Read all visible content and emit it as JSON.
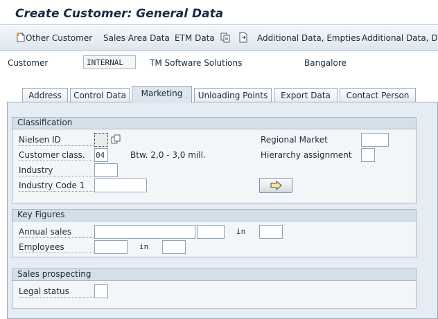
{
  "title": "Create Customer: General Data",
  "toolbar": {
    "other_customer": "Other Customer",
    "sales_area_data": "Sales Area Data",
    "etm_data": "ETM Data",
    "additional_data_empties": "Additional Data, Empties",
    "additional_data_dsd": "Additional Data, DSD",
    "icons": [
      "new-document-icon",
      "copy-icon",
      "export-icon"
    ]
  },
  "customer": {
    "label": "Customer",
    "value": "INTERNAL",
    "name": "TM Software Solutions",
    "city": "Bangalore"
  },
  "tabs": [
    "Address",
    "Control Data",
    "Marketing",
    "Unloading Points",
    "Export Data",
    "Contact Person"
  ],
  "active_tab": "Marketing",
  "classification": {
    "title": "Classification",
    "nielsen_id_label": "Nielsen ID",
    "nielsen_id_value": "",
    "customer_class_label": "Customer class.",
    "customer_class_value": "04",
    "customer_class_desc": "Btw. 2,0 - 3,0 mill.",
    "industry_label": "Industry",
    "industry_value": "",
    "industry_code_label": "Industry Code 1",
    "industry_code_value": "",
    "regional_market_label": "Regional Market",
    "regional_market_value": "",
    "hierarchy_label": "Hierarchy assignment",
    "hierarchy_value": ""
  },
  "key_figures": {
    "title": "Key Figures",
    "annual_sales_label": "Annual sales",
    "annual_sales_value": "",
    "annual_sales_year": "",
    "annual_sales_in": "in",
    "annual_sales_currency": "",
    "employees_label": "Employees",
    "employees_value": "",
    "employees_in": "in",
    "employees_year": ""
  },
  "sales_prospecting": {
    "title": "Sales prospecting",
    "legal_status_label": "Legal status",
    "legal_status_value": ""
  },
  "colors": {
    "panel_bg": "#e5ecf3",
    "group_head_bg": "#d4dfea",
    "title_color": "#162c45"
  }
}
